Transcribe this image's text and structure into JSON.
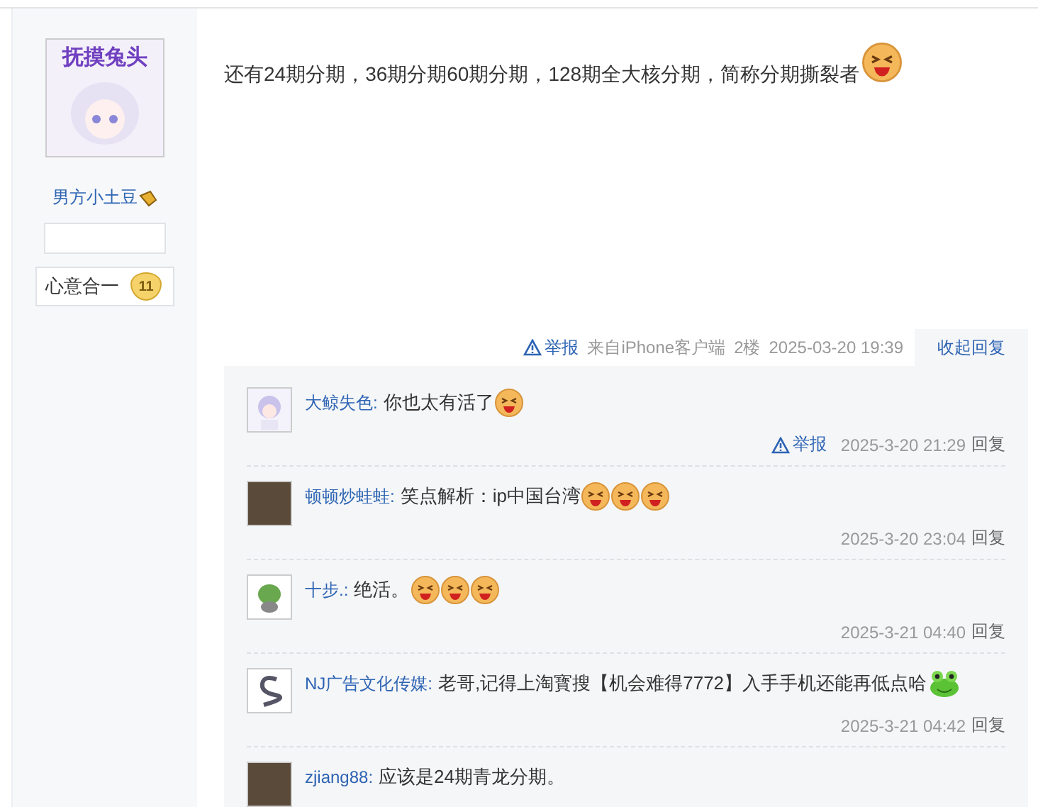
{
  "author": {
    "avatar_caption": "抚摸兔头",
    "name": "男方小土豆",
    "badge": {
      "label": "心意合一",
      "level": "11"
    }
  },
  "post": {
    "text": "还有24期分期，36期分期60期分期，128期全大核分期，简称分期撕裂者",
    "emojis": [
      {
        "kind": "laugh"
      }
    ]
  },
  "meta": {
    "report": "举报",
    "source": "来自iPhone客户端",
    "floor": "2楼",
    "time": "2025-03-20 19:39",
    "toggle": "收起回复"
  },
  "comments": [
    {
      "avatar": {
        "kind": "anime"
      },
      "name": "大鲸失色:",
      "text": "你也太有活了",
      "emojis": [
        {
          "kind": "laugh"
        }
      ],
      "report": "举报",
      "time": "2025-3-20 21:29",
      "reply": "回复"
    },
    {
      "avatar": {
        "kind": "photo"
      },
      "name": "顿顿炒蛙蛙:",
      "text": "笑点解析：ip中国台湾",
      "emojis": [
        {
          "kind": "laugh"
        },
        {
          "kind": "laugh"
        },
        {
          "kind": "laugh"
        }
      ],
      "time": "2025-3-20 23:04",
      "reply": "回复"
    },
    {
      "avatar": {
        "kind": "frog"
      },
      "name": "十步.:",
      "text": "绝活。",
      "emojis": [
        {
          "kind": "laugh"
        },
        {
          "kind": "laugh"
        },
        {
          "kind": "laugh"
        }
      ],
      "time": "2025-3-21 04:40",
      "reply": "回复"
    },
    {
      "avatar": {
        "kind": "letter"
      },
      "name": "NJ广告文化传媒:",
      "text": "老哥,记得上淘寳搜【机会难得7772】入手手机还能再低点哈",
      "emojis": [
        {
          "kind": "frog"
        }
      ],
      "time": "2025-3-21 04:42",
      "reply": "回复"
    },
    {
      "avatar": {
        "kind": "photo"
      },
      "name": "zjiang88:",
      "text": "应该是24期青龙分期。"
    }
  ]
}
